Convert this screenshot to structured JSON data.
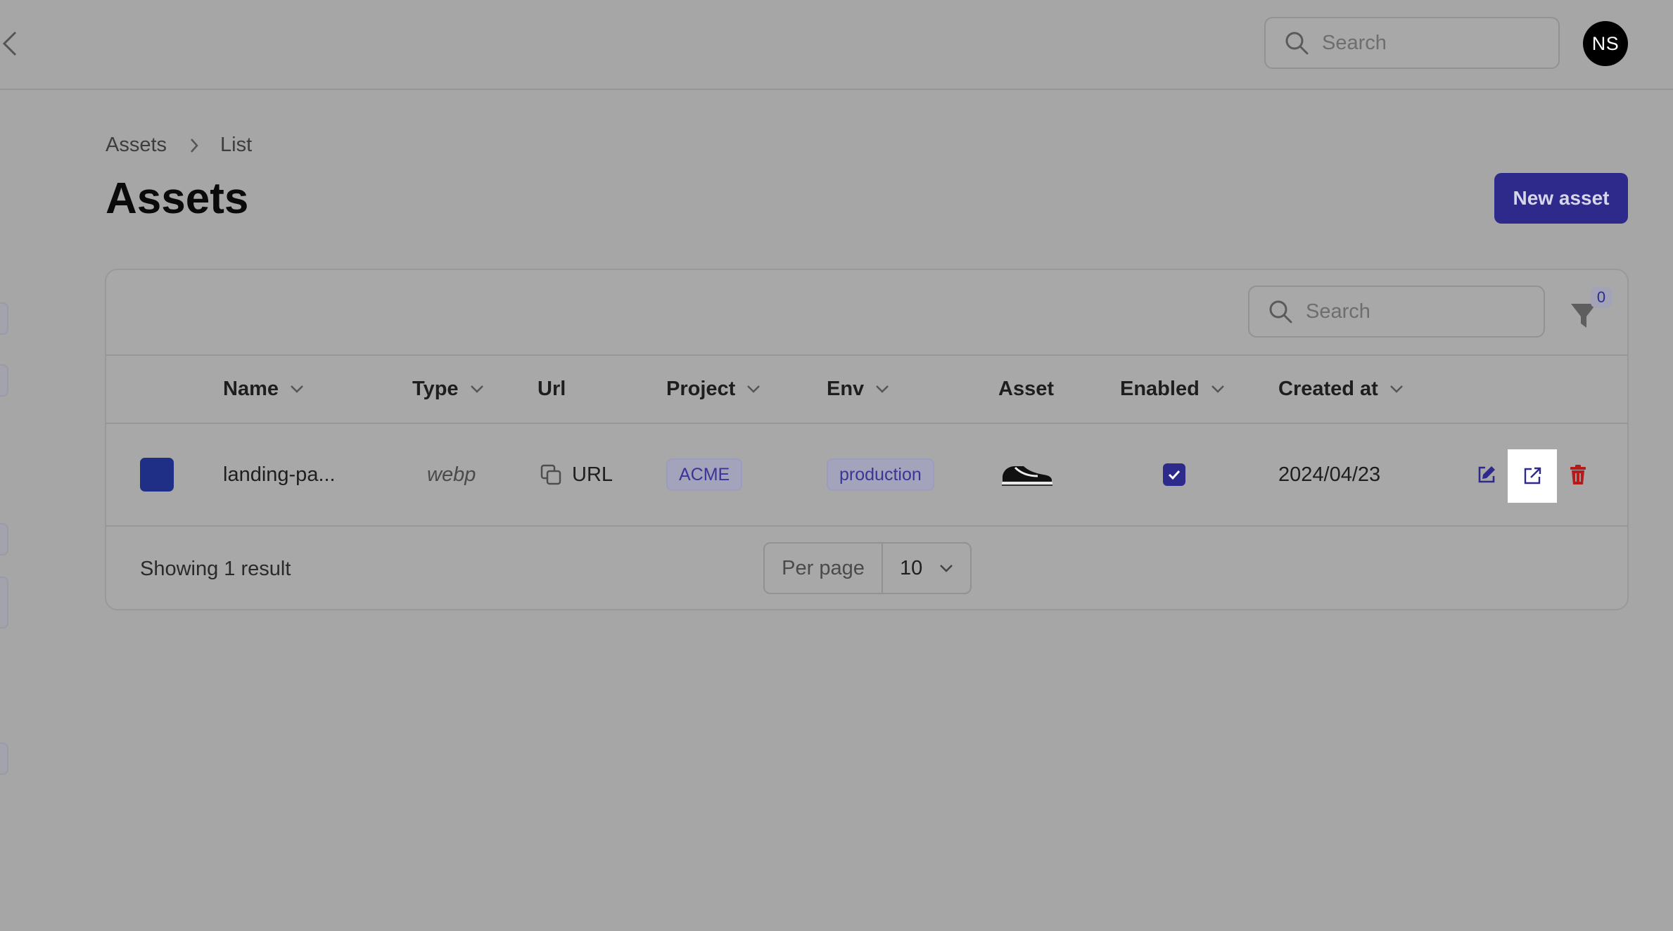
{
  "topbar": {
    "search_placeholder": "Search",
    "avatar_initials": "NS"
  },
  "breadcrumb": {
    "root": "Assets",
    "current": "List"
  },
  "page_title": "Assets",
  "new_asset_label": "New asset",
  "table": {
    "search_placeholder": "Search",
    "filter_count": "0",
    "columns": {
      "name": "Name",
      "type": "Type",
      "url": "Url",
      "project": "Project",
      "env": "Env",
      "asset": "Asset",
      "enabled": "Enabled",
      "created_at": "Created at"
    },
    "rows": [
      {
        "color": "#1f2f86",
        "name": "landing-pa...",
        "type": "webp",
        "url_label": "URL",
        "project": "ACME",
        "env": "production",
        "asset_icon": "sneaker-thumbnail",
        "enabled": true,
        "created_at": "2024/04/23"
      }
    ]
  },
  "footer": {
    "result_count": "Showing 1 result",
    "per_page_label": "Per page",
    "per_page_value": "10"
  },
  "colors": {
    "accent": "#2e2a8c",
    "delete": "#b41c1c",
    "overlay_background": "#a6a6a6"
  }
}
